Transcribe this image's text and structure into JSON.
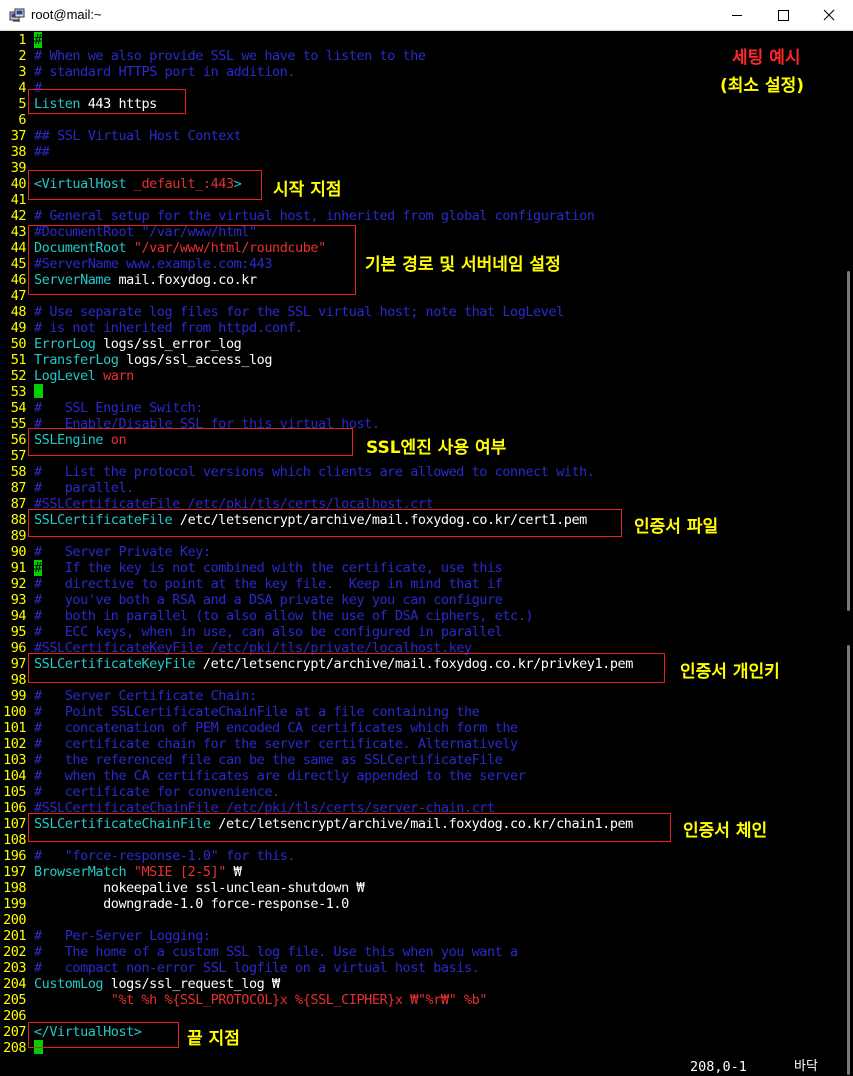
{
  "window": {
    "title": "root@mail:~"
  },
  "lines": [
    {
      "n": "1",
      "segs": [
        {
          "t": "#",
          "c": "cursor-txt"
        }
      ]
    },
    {
      "n": "2",
      "segs": [
        {
          "t": "# When we also provide SSL we have to listen to the",
          "c": "cmt"
        }
      ]
    },
    {
      "n": "3",
      "segs": [
        {
          "t": "# standard HTTPS port in addition.",
          "c": "cmt"
        }
      ]
    },
    {
      "n": "4",
      "segs": [
        {
          "t": "#",
          "c": "cmt"
        }
      ]
    },
    {
      "n": "5",
      "segs": [
        {
          "t": "Listen ",
          "c": "kw"
        },
        {
          "t": "443 https",
          "c": "txt"
        }
      ]
    },
    {
      "n": "6",
      "segs": []
    },
    {
      "n": "37",
      "segs": [
        {
          "t": "## SSL Virtual Host Context",
          "c": "cmt"
        }
      ]
    },
    {
      "n": "38",
      "segs": [
        {
          "t": "##",
          "c": "cmt"
        }
      ]
    },
    {
      "n": "39",
      "segs": []
    },
    {
      "n": "40",
      "segs": [
        {
          "t": "<VirtualHost ",
          "c": "kw"
        },
        {
          "t": "_default_:443",
          "c": "red"
        },
        {
          "t": ">",
          "c": "kw"
        }
      ]
    },
    {
      "n": "41",
      "segs": []
    },
    {
      "n": "42",
      "segs": [
        {
          "t": "# General setup for the virtual host, inherited from global configuration",
          "c": "cmt"
        }
      ]
    },
    {
      "n": "43",
      "segs": [
        {
          "t": "#DocumentRoot \"/var/www/html\"",
          "c": "cmt"
        }
      ]
    },
    {
      "n": "44",
      "segs": [
        {
          "t": "DocumentRoot ",
          "c": "kw"
        },
        {
          "t": "\"/var/www/html/roundcube\"",
          "c": "str"
        }
      ]
    },
    {
      "n": "45",
      "segs": [
        {
          "t": "#ServerName www.example.com:443",
          "c": "cmt"
        }
      ]
    },
    {
      "n": "46",
      "segs": [
        {
          "t": "ServerName ",
          "c": "kw"
        },
        {
          "t": "mail.foxydog.co.kr",
          "c": "txt"
        }
      ]
    },
    {
      "n": "47",
      "segs": []
    },
    {
      "n": "48",
      "segs": [
        {
          "t": "# Use separate log files for the SSL virtual host; note that LogLevel",
          "c": "cmt"
        }
      ]
    },
    {
      "n": "49",
      "segs": [
        {
          "t": "# is not inherited from httpd.conf.",
          "c": "cmt"
        }
      ]
    },
    {
      "n": "50",
      "segs": [
        {
          "t": "ErrorLog ",
          "c": "kw"
        },
        {
          "t": "logs/ssl_error_log",
          "c": "txt"
        }
      ]
    },
    {
      "n": "51",
      "segs": [
        {
          "t": "TransferLog ",
          "c": "kw"
        },
        {
          "t": "logs/ssl_access_log",
          "c": "txt"
        }
      ]
    },
    {
      "n": "52",
      "segs": [
        {
          "t": "LogLevel ",
          "c": "kw"
        },
        {
          "t": "warn",
          "c": "red"
        }
      ]
    },
    {
      "n": "53",
      "segs": [
        {
          "t": "",
          "c": "cursor"
        }
      ]
    },
    {
      "n": "54",
      "segs": [
        {
          "t": "#   SSL Engine Switch:",
          "c": "cmt"
        }
      ]
    },
    {
      "n": "55",
      "segs": [
        {
          "t": "#   Enable/Disable SSL for this virtual host.",
          "c": "cmt"
        }
      ]
    },
    {
      "n": "56",
      "segs": [
        {
          "t": "SSLEngine ",
          "c": "kw"
        },
        {
          "t": "on",
          "c": "red"
        }
      ]
    },
    {
      "n": "57",
      "segs": []
    },
    {
      "n": "58",
      "segs": [
        {
          "t": "#   List the protocol versions which clients are allowed to connect with.",
          "c": "cmt"
        }
      ]
    },
    {
      "n": "87",
      "segs": [
        {
          "t": "#   parallel.",
          "c": "cmt"
        }
      ]
    },
    {
      "n": "87",
      "segs": [
        {
          "t": "#SSLCertificateFile /etc/pki/tls/certs/localhost.crt",
          "c": "cmt"
        }
      ]
    },
    {
      "n": "88",
      "segs": [
        {
          "t": "SSLCertificateFile ",
          "c": "kw"
        },
        {
          "t": "/etc/letsencrypt/archive/mail.foxydog.co.kr/cert1.pem",
          "c": "txt"
        }
      ]
    },
    {
      "n": "89",
      "segs": []
    },
    {
      "n": "90",
      "segs": [
        {
          "t": "#   Server Private Key:",
          "c": "cmt"
        }
      ]
    },
    {
      "n": "91",
      "segs": [
        {
          "t": "#",
          "c": "cursor-txt"
        },
        {
          "t": "   If the key is not combined with the certificate, use this",
          "c": "cmt"
        }
      ]
    },
    {
      "n": "92",
      "segs": [
        {
          "t": "#   directive to point at the key file.  Keep in mind that if",
          "c": "cmt"
        }
      ]
    },
    {
      "n": "93",
      "segs": [
        {
          "t": "#   you've both a RSA and a DSA private key you can configure",
          "c": "cmt"
        }
      ]
    },
    {
      "n": "94",
      "segs": [
        {
          "t": "#   both in parallel (to also allow the use of DSA ciphers, etc.)",
          "c": "cmt"
        }
      ]
    },
    {
      "n": "95",
      "segs": [
        {
          "t": "#   ECC keys, when in use, can also be configured in parallel",
          "c": "cmt"
        }
      ]
    },
    {
      "n": "96",
      "segs": [
        {
          "t": "#SSLCertificateKeyFile /etc/pki/tls/private/localhost.key",
          "c": "cmt"
        }
      ]
    },
    {
      "n": "97",
      "segs": [
        {
          "t": "SSLCertificateKeyFile ",
          "c": "kw"
        },
        {
          "t": "/etc/letsencrypt/archive/mail.foxydog.co.kr/privkey1.pem",
          "c": "txt"
        }
      ]
    },
    {
      "n": "98",
      "segs": []
    },
    {
      "n": "99",
      "segs": [
        {
          "t": "#   Server Certificate Chain:",
          "c": "cmt"
        }
      ]
    },
    {
      "n": "100",
      "segs": [
        {
          "t": "#   Point SSLCertificateChainFile at a file containing the",
          "c": "cmt"
        }
      ]
    },
    {
      "n": "101",
      "segs": [
        {
          "t": "#   concatenation of PEM encoded CA certificates which form the",
          "c": "cmt"
        }
      ]
    },
    {
      "n": "102",
      "segs": [
        {
          "t": "#   certificate chain for the server certificate. Alternatively",
          "c": "cmt"
        }
      ]
    },
    {
      "n": "103",
      "segs": [
        {
          "t": "#   the referenced file can be the same as SSLCertificateFile",
          "c": "cmt"
        }
      ]
    },
    {
      "n": "104",
      "segs": [
        {
          "t": "#   when the CA certificates are directly appended to the server",
          "c": "cmt"
        }
      ]
    },
    {
      "n": "105",
      "segs": [
        {
          "t": "#   certificate for convenience.",
          "c": "cmt"
        }
      ]
    },
    {
      "n": "106",
      "segs": [
        {
          "t": "#SSLCertificateChainFile /etc/pki/tls/certs/server-chain.crt",
          "c": "cmt"
        }
      ]
    },
    {
      "n": "107",
      "segs": [
        {
          "t": "SSLCertificateChainFile ",
          "c": "kw"
        },
        {
          "t": "/etc/letsencrypt/archive/mail.foxydog.co.kr/chain1.pem",
          "c": "txt"
        }
      ]
    },
    {
      "n": "108",
      "segs": []
    },
    {
      "n": "196",
      "segs": [
        {
          "t": "#   \"force-response-1.0\" for this.",
          "c": "cmt"
        }
      ]
    },
    {
      "n": "197",
      "segs": [
        {
          "t": "BrowserMatch ",
          "c": "kw"
        },
        {
          "t": "\"MSIE [2-5]\"",
          "c": "str"
        },
        {
          "t": " ₩",
          "c": "txt"
        }
      ]
    },
    {
      "n": "198",
      "segs": [
        {
          "t": "         nokeepalive ssl-unclean-shutdown ₩",
          "c": "txt"
        }
      ]
    },
    {
      "n": "199",
      "segs": [
        {
          "t": "         downgrade-1.0 force-response-1.0",
          "c": "txt"
        }
      ]
    },
    {
      "n": "200",
      "segs": []
    },
    {
      "n": "201",
      "segs": [
        {
          "t": "#   Per-Server Logging:",
          "c": "cmt"
        }
      ]
    },
    {
      "n": "202",
      "segs": [
        {
          "t": "#   The home of a custom SSL log file. Use this when you want a",
          "c": "cmt"
        }
      ]
    },
    {
      "n": "203",
      "segs": [
        {
          "t": "#   compact non-error SSL logfile on a virtual host basis.",
          "c": "cmt"
        }
      ]
    },
    {
      "n": "204",
      "segs": [
        {
          "t": "CustomLog ",
          "c": "kw"
        },
        {
          "t": "logs/ssl_request_log ₩",
          "c": "txt"
        }
      ]
    },
    {
      "n": "205",
      "segs": [
        {
          "t": "          \"%t %h %{SSL_PROTOCOL}x %{SSL_CIPHER}x ₩\"%r₩\" %b\"",
          "c": "str"
        }
      ]
    },
    {
      "n": "206",
      "segs": []
    },
    {
      "n": "207",
      "segs": [
        {
          "t": "</VirtualHost>",
          "c": "kw"
        }
      ]
    },
    {
      "n": "208",
      "segs": [
        {
          "t": "",
          "c": "cursor"
        }
      ]
    }
  ],
  "annotations": {
    "settings_example_line1": "세팅 예시",
    "settings_example_line2": "(최소 설정)",
    "start_point": "시작 지점",
    "docroot_servername": "기본 경로 및 서버네임 설정",
    "ssl_engine": "SSL엔진 사용 여부",
    "cert_file": "인증서 파일",
    "private_key": "인증서 개인키",
    "cert_chain": "인증서 체인",
    "end_point": "끝 지점"
  },
  "status": {
    "position": "208,0-1",
    "scroll": "바닥"
  },
  "colors": {
    "comment": "#2a2acc",
    "keyword": "#22c8c8",
    "string": "#e63030",
    "line_number": "#ffff00",
    "annotation": "#ffff00",
    "box": "#e82020"
  }
}
